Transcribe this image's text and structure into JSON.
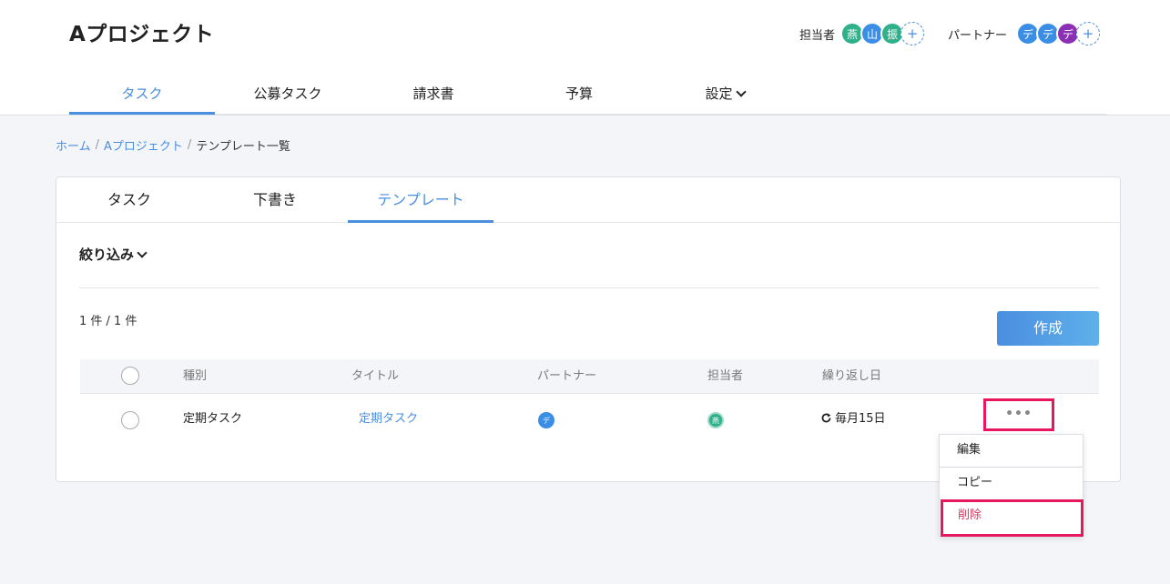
{
  "project": {
    "title": "Aプロジェクト"
  },
  "assignees": {
    "label": "担当者",
    "members": [
      {
        "initial": "燕",
        "color": "#2eb08a"
      },
      {
        "initial": "山",
        "color": "#3a8ee6"
      },
      {
        "initial": "振",
        "color": "#2eb08a"
      }
    ],
    "add_label": "+"
  },
  "partners": {
    "label": "パートナー",
    "members": [
      {
        "initial": "デ",
        "color": "#3a8ee6"
      },
      {
        "initial": "デ",
        "color": "#3a8ee6"
      },
      {
        "initial": "デ",
        "color": "#8b2fb5"
      }
    ],
    "add_label": "+"
  },
  "nav": {
    "tabs": [
      {
        "label": "タスク",
        "active": true
      },
      {
        "label": "公募タスク"
      },
      {
        "label": "請求書"
      },
      {
        "label": "予算"
      },
      {
        "label": "設定"
      }
    ]
  },
  "breadcrumb": {
    "home": "ホーム",
    "project": "Aプロジェクト",
    "current": "テンプレート一覧",
    "separator": "/"
  },
  "subtabs": [
    {
      "label": "タスク"
    },
    {
      "label": "下書き"
    },
    {
      "label": "テンプレート",
      "active": true
    }
  ],
  "filter": {
    "label": "絞り込み"
  },
  "count": {
    "text": "1 件 / 1 件"
  },
  "create_button": {
    "label": "作成"
  },
  "table": {
    "headers": [
      "種別",
      "タイトル",
      "パートナー",
      "担当者",
      "繰り返し日"
    ],
    "rows": [
      {
        "type": "定期タスク",
        "title": "定期タスク",
        "partner": {
          "initial": "デ",
          "color": "#3a8ee6"
        },
        "assignee": {
          "initial": "燕",
          "color": "#2eb08a"
        },
        "repeat": "毎月15日",
        "more_label": "•••"
      }
    ]
  },
  "dropdown": {
    "items": [
      {
        "label": "編集"
      },
      {
        "label": "コピー"
      },
      {
        "label": "削除",
        "danger": true
      }
    ]
  },
  "colors": {
    "accent": "#4a8ee0",
    "highlight": "#e8175d",
    "danger_text": "#d63b5c"
  }
}
